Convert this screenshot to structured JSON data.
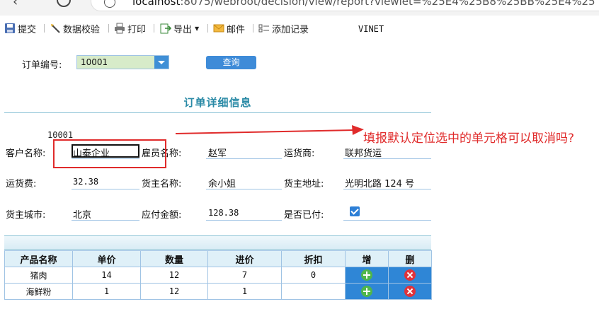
{
  "browser": {
    "url_host": "localhost",
    "url_rest": ":8075/webroot/decision/view/report?viewlet=%25E4%25B8%25BB%25E4%25"
  },
  "toolbar": {
    "submit": "提交",
    "validate": "数据校验",
    "print": "打印",
    "export": "导出",
    "mail": "邮件",
    "add_record": "添加记录",
    "title": "VINET"
  },
  "param": {
    "label": "订单编号:",
    "value": "10001",
    "query_button": "查询"
  },
  "report": {
    "title": "订单详细信息",
    "order_id": "10001",
    "fields": {
      "customer_label": "客户名称:",
      "customer_value": "山泰企业",
      "employee_label": "雇员名称:",
      "employee_value": "赵军",
      "shipper_label": "运货商:",
      "shipper_value": "联邦货运",
      "freight_label": "运货费:",
      "freight_value": "32.38",
      "consignee_label": "货主名称:",
      "consignee_value": "余小姐",
      "address_label": "货主地址:",
      "address_value": "光明北路 124 号",
      "city_label": "货主城市:",
      "city_value": "北京",
      "amount_label": "应付金额:",
      "amount_value": "128.38",
      "paid_label": "是否已付:",
      "paid_checked": true
    },
    "table": {
      "headers": [
        "产品名称",
        "单价",
        "数量",
        "进价",
        "折扣",
        "增",
        "删"
      ],
      "rows": [
        [
          "猪肉",
          "14",
          "12",
          "7",
          "0"
        ],
        [
          "海鲜粉",
          "1",
          "12",
          "1",
          ""
        ]
      ]
    }
  },
  "annotation": {
    "text": "填报默认定位选中的单元格可以取消吗?"
  },
  "colors": {
    "accent": "#2a8aa6",
    "button": "#3e8bd8",
    "annotation": "#e02b2b",
    "field_line": "#9fc3e4"
  }
}
